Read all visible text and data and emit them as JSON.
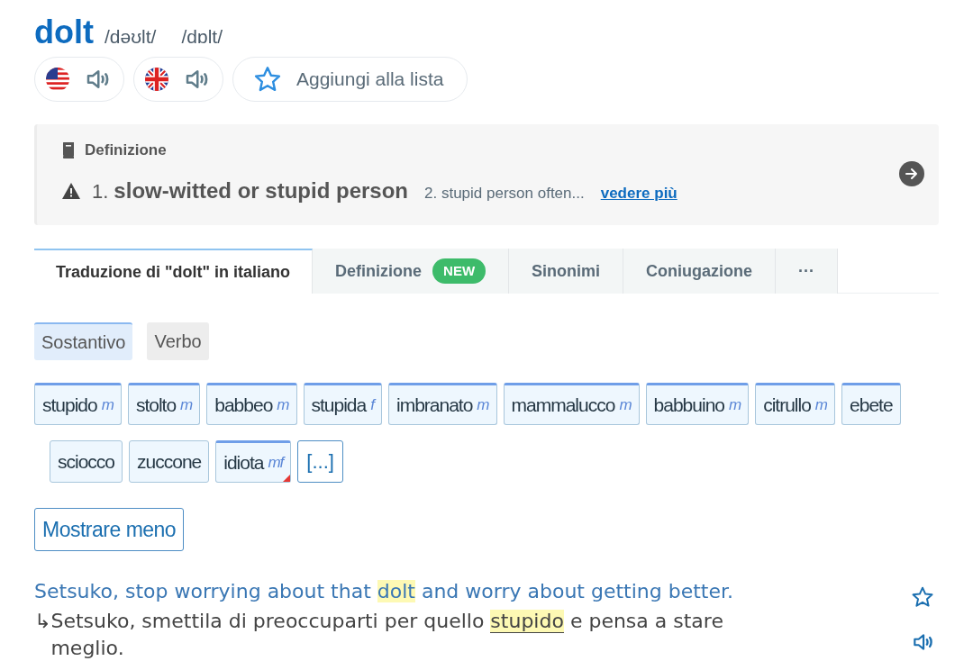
{
  "headword": "dolt",
  "pronunciations": [
    "/dəʊlt/",
    "/dɒlt/"
  ],
  "audio_buttons": [
    {
      "kind": "us"
    },
    {
      "kind": "uk"
    }
  ],
  "add_to_list": "Aggiungi alla lista",
  "definition_card": {
    "heading": "Definizione",
    "number_1": "1.",
    "meaning_1": "slow-witted or stupid person",
    "meaning_2": "2. stupid person often...",
    "more_link": "vedere più"
  },
  "tabs": [
    {
      "label": "Traduzione di \"dolt\" in italiano",
      "selected": true
    },
    {
      "label": "Definizione",
      "badge": "NEW",
      "selected": false
    },
    {
      "label": "Sinonimi",
      "selected": false
    },
    {
      "label": "Coniugazione",
      "selected": false
    },
    {
      "label": "···",
      "selected": false
    }
  ],
  "parts_of_speech": [
    {
      "label": "Sostantivo",
      "selected": true
    },
    {
      "label": "Verbo",
      "selected": false
    }
  ],
  "translations": [
    {
      "word": "stupido",
      "gender": "m",
      "frequent": true,
      "flagged": false
    },
    {
      "word": "stolto",
      "gender": "m",
      "frequent": true,
      "flagged": false
    },
    {
      "word": "babbeo",
      "gender": "m",
      "frequent": true,
      "flagged": false
    },
    {
      "word": "stupida",
      "gender": "f",
      "frequent": true,
      "flagged": false
    },
    {
      "word": "imbranato",
      "gender": "m",
      "frequent": true,
      "flagged": false
    },
    {
      "word": "mammalucco",
      "gender": "m",
      "frequent": true,
      "flagged": false
    },
    {
      "word": "babbuino",
      "gender": "m",
      "frequent": true,
      "flagged": false
    },
    {
      "word": "citrullo",
      "gender": "m",
      "frequent": true,
      "flagged": false
    },
    {
      "word": "ebete",
      "frequent": true,
      "flagged": false
    },
    {
      "word": "sciocco",
      "frequent": false,
      "flagged": false
    },
    {
      "word": "zuccone",
      "frequent": false,
      "flagged": false
    },
    {
      "word": "idiota",
      "gender": "mf",
      "frequent": true,
      "flagged": true
    }
  ],
  "more_button": "[...]",
  "show_less_button": "Mostrare meno",
  "example": {
    "source": "Setsuko, stop worrying about that **dolt** and worry about getting better.",
    "arrow": "↳",
    "target": "Setsuko, smettila di preoccuparti per quello **stupido** e pensa a stare meglio."
  }
}
